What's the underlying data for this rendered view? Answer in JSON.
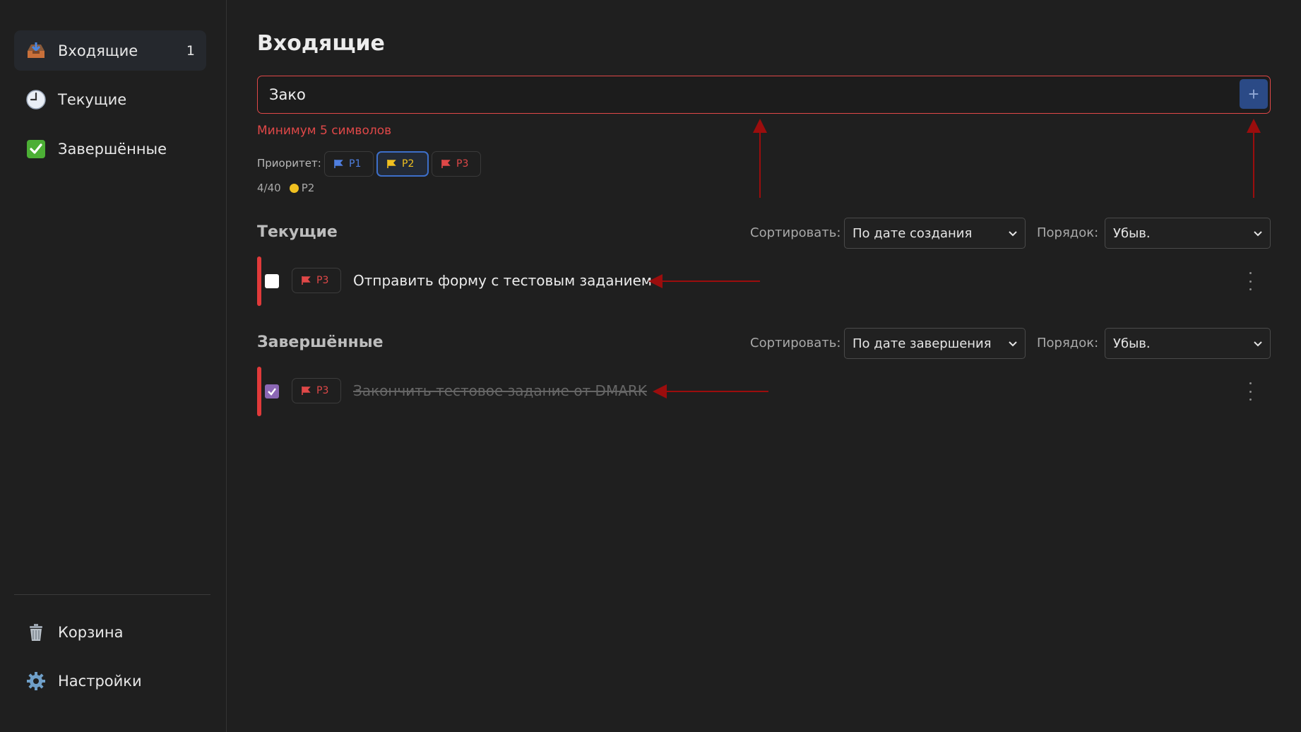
{
  "sidebar": {
    "items": [
      {
        "label": "Входящие",
        "icon": "inbox-tray-icon",
        "count": "1",
        "active": true
      },
      {
        "label": "Текущие",
        "icon": "clock-icon"
      },
      {
        "label": "Завершённые",
        "icon": "check-mark-icon"
      }
    ],
    "bottom_items": [
      {
        "label": "Корзина",
        "icon": "trash-icon"
      },
      {
        "label": "Настройки",
        "icon": "gear-icon"
      }
    ]
  },
  "main": {
    "title": "Входящие",
    "new_task": {
      "value": "Зако",
      "add_button": "+",
      "error": "Минимум 5 символов",
      "priority_label": "Приоритет:",
      "priorities": [
        {
          "label": "P1",
          "color": "#4f7fe0"
        },
        {
          "label": "P2",
          "color": "#f0c020",
          "selected": true
        },
        {
          "label": "P3",
          "color": "#e04848"
        }
      ],
      "char_count": "4/40",
      "current_priority": "P2"
    },
    "sections": [
      {
        "title": "Текущие",
        "sort_label": "Сортировать:",
        "sort_value": "По дате создания",
        "order_label": "Порядок:",
        "order_value": "Убыв.",
        "tasks": [
          {
            "priority": "P3",
            "text": "Отправить форму с тестовым заданием",
            "done": false
          }
        ]
      },
      {
        "title": "Завершённые",
        "sort_label": "Сортировать:",
        "sort_value": "По дате завершения",
        "order_label": "Порядок:",
        "order_value": "Убыв.",
        "tasks": [
          {
            "priority": "P3",
            "text": "Закончить тестовое задание от DMARK",
            "done": true
          }
        ]
      }
    ]
  },
  "colors": {
    "accent_blue": "#2b4a86",
    "error_red": "#e04848",
    "priority_bar": "#e03a3a",
    "annotation_arrow": "#9b0d0d"
  }
}
